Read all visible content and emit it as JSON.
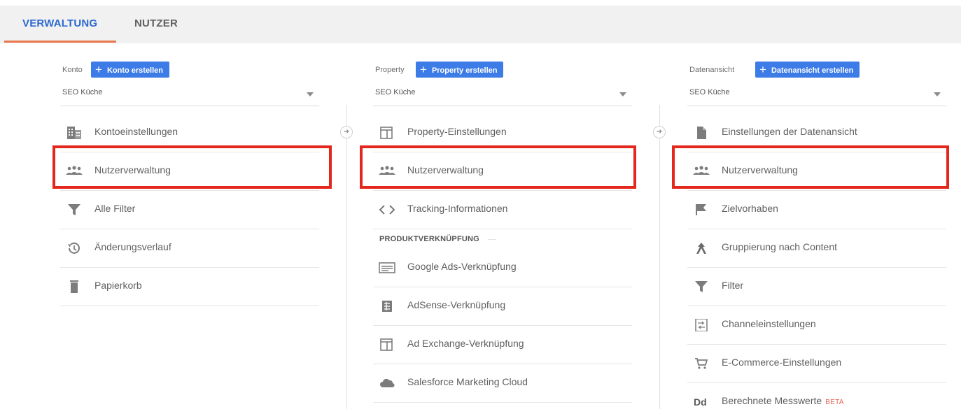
{
  "tabs": {
    "admin": "VERWALTUNG",
    "user": "NUTZER"
  },
  "columns": {
    "account": {
      "label": "Konto",
      "create_button": "Konto erstellen",
      "selected": "SEO Küche",
      "items": [
        {
          "label": "Kontoeinstellungen",
          "icon": "building-icon"
        },
        {
          "label": "Nutzerverwaltung",
          "icon": "people-icon"
        },
        {
          "label": "Alle Filter",
          "icon": "filter-icon"
        },
        {
          "label": "Änderungsverlauf",
          "icon": "history-icon"
        },
        {
          "label": "Papierkorb",
          "icon": "trash-icon"
        }
      ]
    },
    "property": {
      "label": "Property",
      "create_button": "Property erstellen",
      "selected": "SEO Küche",
      "items": [
        {
          "label": "Property-Einstellungen",
          "icon": "property-window-icon"
        },
        {
          "label": "Nutzerverwaltung",
          "icon": "people-icon"
        },
        {
          "label": "Tracking-Informationen",
          "icon": "code-icon"
        }
      ],
      "section_title": "PRODUKTVERKNÜPFUNG",
      "link_items": [
        {
          "label": "Google Ads-Verknüpfung",
          "icon": "ads-icon"
        },
        {
          "label": "AdSense-Verknüpfung",
          "icon": "adsense-icon"
        },
        {
          "label": "Ad Exchange-Verknüpfung",
          "icon": "adexchange-icon"
        },
        {
          "label": "Salesforce Marketing Cloud",
          "icon": "cloud-icon"
        }
      ]
    },
    "view": {
      "label": "Datenansicht",
      "create_button": "Datenansicht erstellen",
      "selected": "SEO Küche",
      "items": [
        {
          "label": "Einstellungen der Datenansicht",
          "icon": "document-icon"
        },
        {
          "label": "Nutzerverwaltung",
          "icon": "people-icon"
        },
        {
          "label": "Zielvorhaben",
          "icon": "flag-icon"
        },
        {
          "label": "Gruppierung nach Content",
          "icon": "content-grouping-icon"
        },
        {
          "label": "Filter",
          "icon": "filter-icon"
        },
        {
          "label": "Channeleinstellungen",
          "icon": "channel-settings-icon"
        },
        {
          "label": "E-Commerce-Einstellungen",
          "icon": "cart-icon"
        },
        {
          "label": "Berechnete Messwerte",
          "icon": "dd-icon",
          "badge": "BETA"
        }
      ]
    }
  },
  "colors": {
    "accent_blue": "#3d7ce6",
    "tab_active": "#2b69cf",
    "highlight_red": "#e3271d",
    "beta_badge": "#e8675a"
  }
}
